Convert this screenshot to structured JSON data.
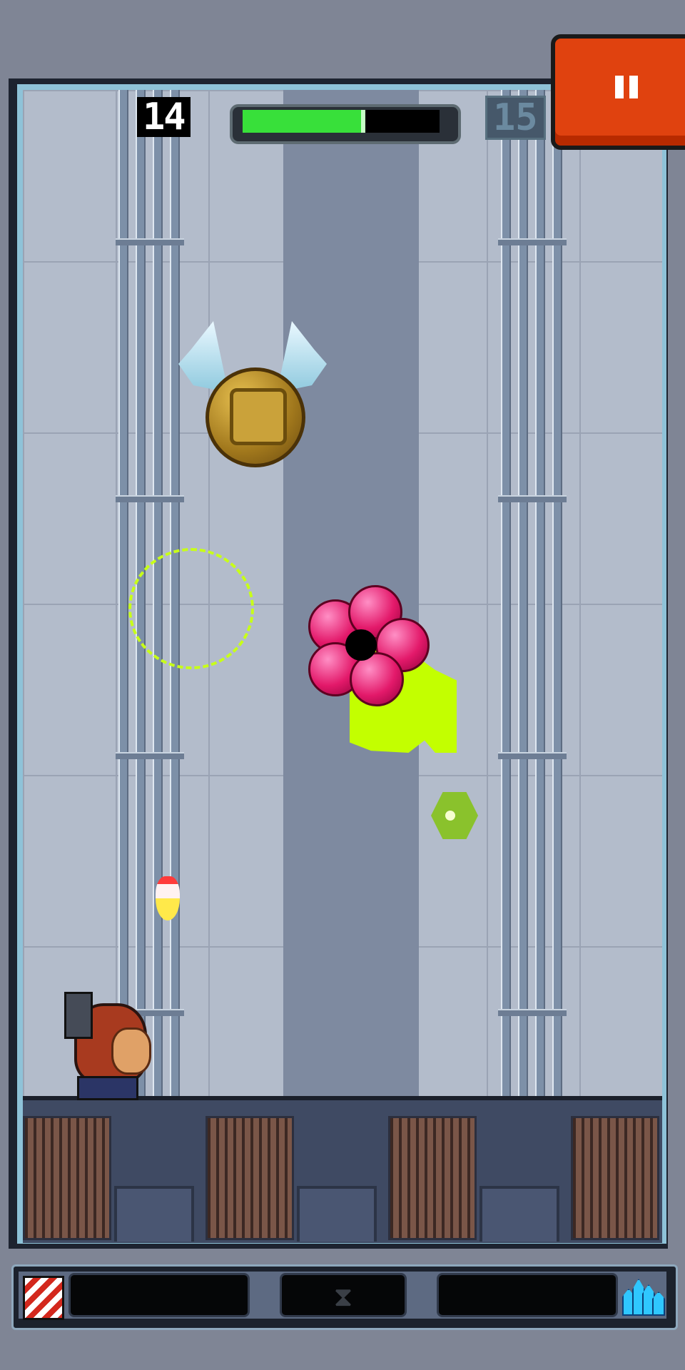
{
  "hud": {
    "current_level": "14",
    "next_level": "15",
    "progress_fraction": 0.6,
    "pause_label": "pause"
  },
  "bottom_bar": {
    "left_item_icon": "candy-cane-icon",
    "center_item_icon": "hourglass-icon",
    "center_item_glyph": "⧗",
    "right_item_icon": "crystal-icon"
  },
  "objects": {
    "powerup": "winged-hourglass-coin",
    "enemy": "pink-orb-cluster",
    "pickup": "green-gem",
    "projectile": "bullet",
    "player": "hero-with-cannon"
  },
  "colors": {
    "pause_button": "#e0420f",
    "progress_fill": "#38e03a",
    "slime": "#c3ff00",
    "orb": "#e3196a"
  }
}
